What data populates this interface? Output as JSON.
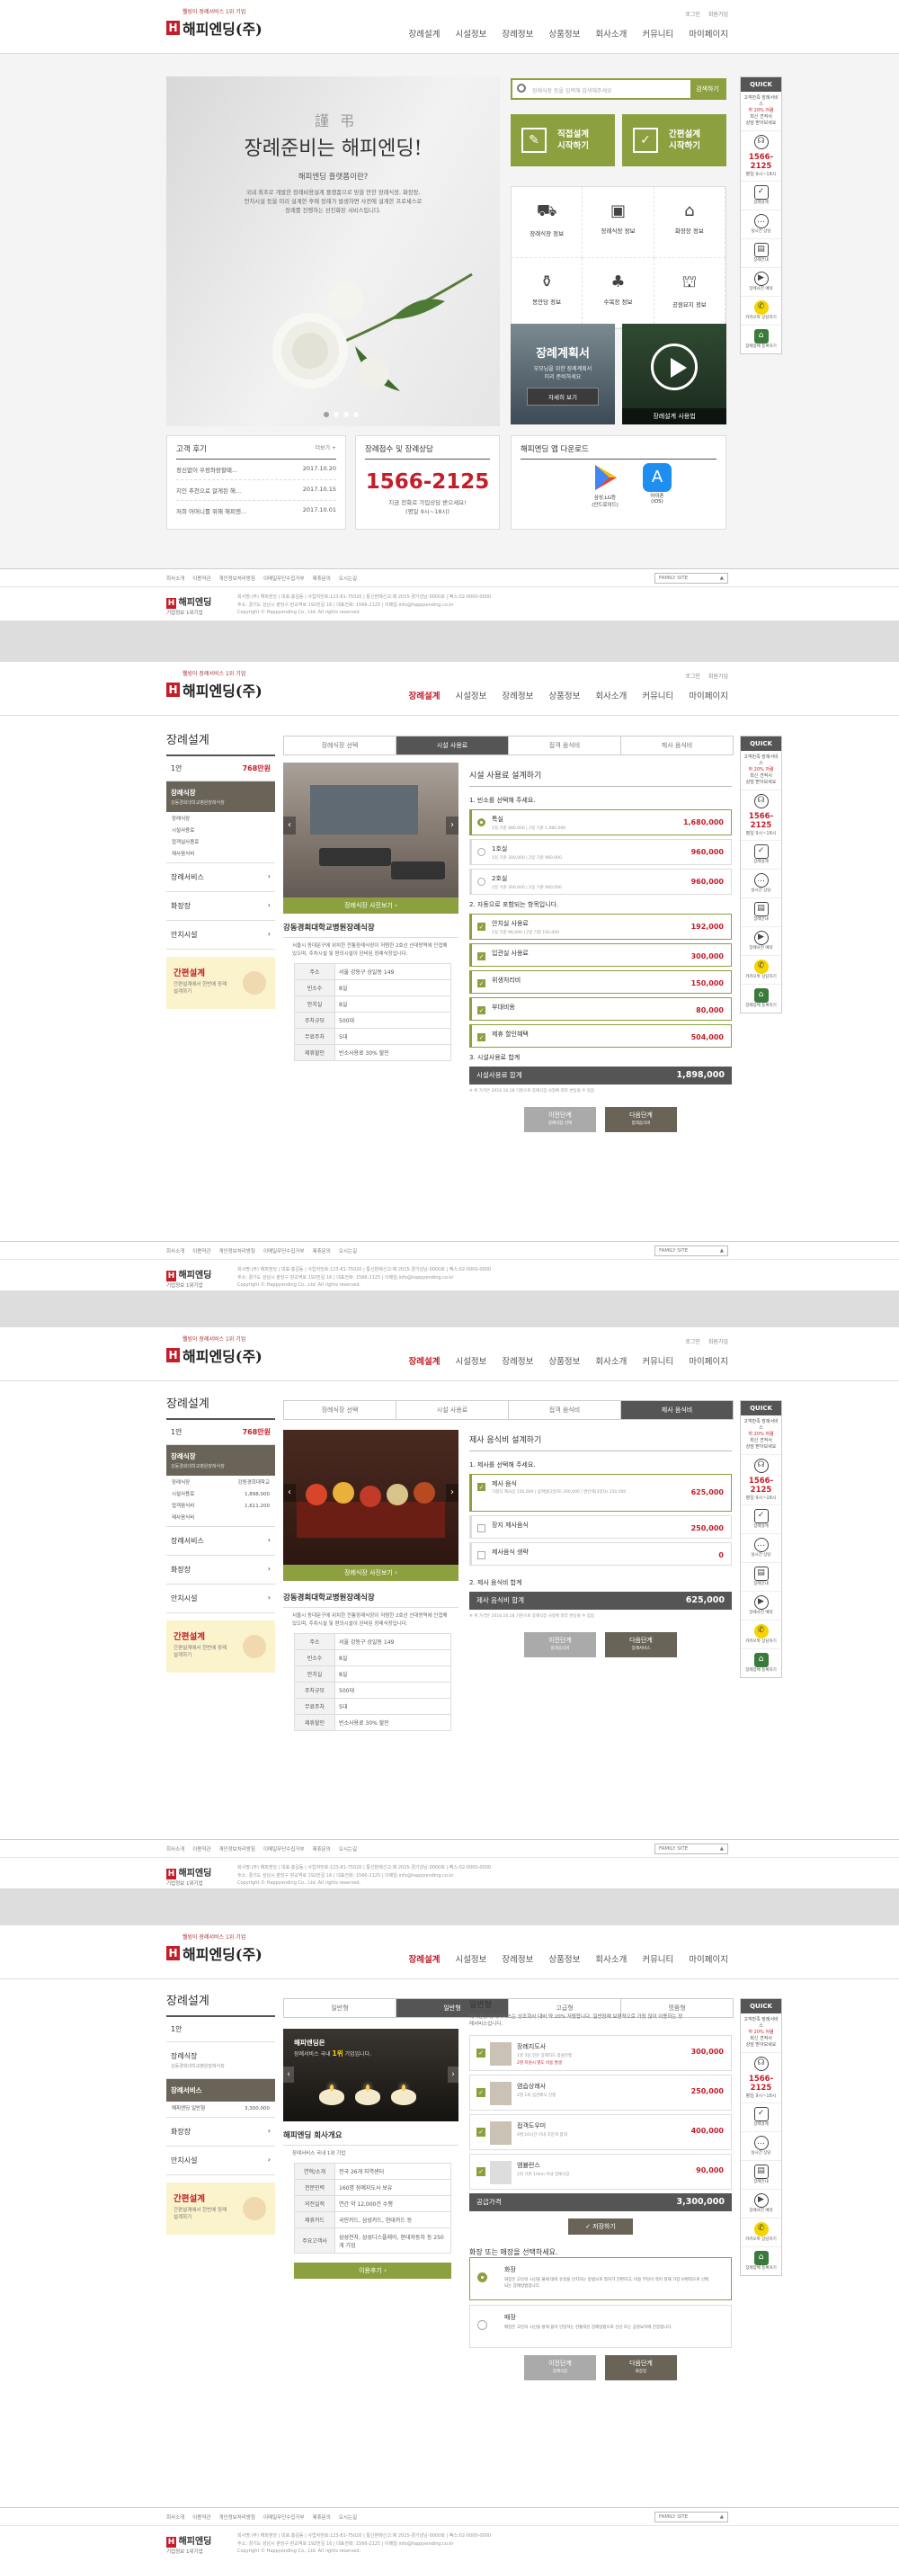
{
  "brand": {
    "tagline": "웰빙이 장례서비스 1위 기업",
    "name": "해피엔딩(주)",
    "ft_name": "해피엔딩",
    "ft_sub": "기업정보 1위기업"
  },
  "util": [
    "로그인",
    "회원가입"
  ],
  "gnb": [
    "장례설계",
    "시설정보",
    "장례정보",
    "상품정보",
    "회사소개",
    "커뮤니티",
    "마이페이지"
  ],
  "quick": {
    "title": "QUICK",
    "slogan1": "고객만족 장례서비스",
    "slogan2": "하 20% 저렴",
    "slogan3": "최신 견적서",
    "slogan4": "상담 받아보세요",
    "phone": "1566-2125",
    "hours": "평일 9시~18시",
    "items": [
      "장례설계",
      "실시간 상담",
      "장례안내",
      "장례사전 예약",
      "카카오톡 상담하기",
      "장례업체 등록하기"
    ]
  },
  "footer": {
    "links": [
      "회사소개",
      "이용약관",
      "개인정보처리방침",
      "이메일무단수집거부",
      "제휴문의",
      "오시는길"
    ],
    "family": "FAMILY SITE",
    "addr1": "회사명:(주) 해피엔딩 | 대표:홍길동 | 사업자번호:123-81-75020 | 통신판매신고:제 2015-경기성남-0000호 | 팩스:02-0000-0000",
    "addr2": "주소: 경기도 성남시 분당구 판교역로 192번길 16 | 대표전화: 1566-2125 | 이메일:info@happyending.co.kr",
    "copy": "Copyright © Happyending Co., Ltd. All rights reserved."
  },
  "home": {
    "hero": {
      "stamp": "謹弔",
      "title": "장례준비는 해피엔딩!",
      "subtitle": "해피엔딩 플랫폼이란?",
      "desc": "국내 최초로 개발한 장례비용설계 플랫폼으로 믿을 만한 장례식장, 화장장, 안치시설 등을 미리 설계한 후에 장례가 발생하면 사전에 설계한 프로세스로 장례를 진행하는 선진화된 서비스입니다."
    },
    "search": {
      "placeholder": "장례식장 등을 입력해 검색해주세요",
      "button": "검색하기"
    },
    "btn1": [
      "직접설계",
      "시작하기"
    ],
    "btn2": [
      "간편설계",
      "시작하기"
    ],
    "icons": [
      "장례식장 정보",
      "장례식장 정보",
      "화장장 정보",
      "봉안당 정보",
      "수목장 정보",
      "공원묘지 정보"
    ],
    "promo": {
      "t1": "장례계획서",
      "t2": "부모님을 위한 장례계획서",
      "t3": "미리 준비하세요",
      "btn": "자세히 보기"
    },
    "video": "장례설계 사용법",
    "review": {
      "title": "고객 후기",
      "more": "더보기 +",
      "items": [
        {
          "t": "정신없이 우왕좌왕할때...",
          "d": "2017.10.20"
        },
        {
          "t": "지인 추천으로 알게된 해...",
          "d": "2017.10.15"
        },
        {
          "t": "저희 어머니를 위해 해피엔...",
          "d": "2017.10.01"
        }
      ]
    },
    "call": {
      "title": "장례접수 및 장례상담",
      "phone": "1566-2125",
      "l1": "지금 전화로 가입상담 받으세요!",
      "l2": "(평일 9시~18시)"
    },
    "app": {
      "title": "해피엔딩 앱 다운로드",
      "a": "삼성,LG등",
      "a2": "(안드로이드)",
      "b": "아이폰",
      "b2": "(iOS)"
    }
  },
  "p2": {
    "menu": {
      "title": "장례설계",
      "day": "1안",
      "price": "768만원",
      "cat": "장례식장",
      "catsub": "강동경희대학교병원장례식장",
      "subs": [
        "장례식장",
        "강동경희대학교",
        "시설사용료",
        "접객실사용료",
        "제사음식비"
      ],
      "items": [
        "장례서비스",
        "화장장",
        "안치시설"
      ],
      "simple": "간편설계",
      "simple_d": "간편설계에서 한번에 장례 설계하기"
    },
    "steps": [
      "장례식장 선택",
      "시설 사용료",
      "접객 음식비",
      "제사 음식비"
    ],
    "photo": "장례식장 사진보기",
    "place": {
      "name": "강동경희대학교병원장례식장",
      "desc": "서울시 동대문구에 위치한 전통장례식장이 저렴한 2호선 신대방역에 인접해 있으며, 주차시설 및 편의시설이 완비된 장례식장입니다.",
      "rows": [
        [
          "주소",
          "서울 강동구 상일동 149"
        ],
        [
          "빈소수",
          "8실"
        ],
        [
          "안치실",
          "8실"
        ],
        [
          "주차규모",
          "500대"
        ],
        [
          "무료주차",
          "5대"
        ],
        [
          "제휴할인",
          "빈소사용료 30% 할인"
        ]
      ]
    },
    "h": "시설 사용료 설계하기",
    "q1": "1. 빈소를 선택해 주세요.",
    "rooms": [
      {
        "n": "특실",
        "s": "1일 기준 480,000 | 2일 기준 1,680,000",
        "p": "1,680,000"
      },
      {
        "n": "1호실",
        "s": "1일 기준 300,000 | 2일 기준 960,000",
        "p": "960,000"
      },
      {
        "n": "2호실",
        "s": "1일 기준 300,000 | 2일 기준 960,000",
        "p": "960,000"
      }
    ],
    "q2": "2. 자동으로 포함되는 항목입니다.",
    "auto": [
      {
        "n": "안치실 사용료",
        "s": "1일 기준 96,000 | 2일 기준 192,000",
        "p": "192,000"
      },
      {
        "n": "입관실 사용료",
        "s": "",
        "p": "300,000"
      },
      {
        "n": "위생처리비",
        "s": "",
        "p": "150,000"
      },
      {
        "n": "부대비용",
        "s": "",
        "p": "80,000"
      },
      {
        "n": "제휴 할인혜택",
        "s": "",
        "p": "504,000"
      }
    ],
    "q3": "3. 시설사용료 합계",
    "total_l": "시설사용료 합계",
    "total": "1,898,000",
    "note": "※ 위 가격은 2016.10.18 기준으로 장례식장 사정에 따라 변동될 수 있음",
    "prev": "이전단계",
    "prev_s": "장례식장 선택",
    "next": "다음단계",
    "next_s": "접객음식비"
  },
  "p3": {
    "steps": [
      "장례식장 선택",
      "시설 사용료",
      "접객 음식비",
      "제사 음식비"
    ],
    "subs": [
      [
        "장례식장",
        "강동경희대학교"
      ],
      [
        "시설사용료",
        "1,898,000"
      ],
      [
        "접객음식비",
        "1,611,200"
      ],
      [
        "제사음식비",
        ""
      ]
    ],
    "photo": "장례식장 사진보기",
    "h": "제사 음식비 설계하기",
    "q1": "1. 제사를 선택해 주세요.",
    "opts": [
      {
        "n": "제사 음식",
        "s": "가정식 제사상 150,000 | 상여밥(2일차) 200,000 | 발인제(3일차) 150,000",
        "p": "625,000"
      },
      {
        "n": "장지 제사음식",
        "s": "",
        "p": "250,000"
      },
      {
        "n": "제사음식 생략",
        "s": "",
        "p": "0"
      }
    ],
    "q2": "2. 제사 음식비 합계",
    "total_l": "제사 음식비 합계",
    "total": "625,000",
    "prev_s": "접객음식비",
    "next_s": "장례서비스"
  },
  "p4": {
    "subs": [
      [
        "장례식장",
        "강동경희대학교병원장례식장"
      ]
    ],
    "cat2": "장례서비스",
    "cat2sub": "해피엔딩 일반형",
    "cat2p": "3,300,000",
    "steps": [
      "일반형",
      "일반형",
      "고급형",
      "명품형"
    ],
    "banner": {
      "t1": "해피엔딩은",
      "t2": "장례서비스 국내",
      "t3": "1위",
      "t4": "기업입니다."
    },
    "co": {
      "name": "해피엔딩 회사개요",
      "desc": "장례서비스 국내 1위 기업",
      "rows": [
        [
          "연혁/소개",
          "전국 26개 지역센터"
        ],
        [
          "전문인력",
          "160명 장례지도사 보유"
        ],
        [
          "의전실적",
          "연간 약 12,000건 수행"
        ],
        [
          "제휴카드",
          "국민카드, 삼성카드, 현대카드 등"
        ],
        [
          "주요고객사",
          "삼성전자, 삼성디스플레이, 현대자동차 등 250개 기업"
        ]
      ],
      "btn": "이용후기"
    },
    "h": "일반형",
    "intro": "해피엔딩 장례서비스는 상조회사 대비 약 20% 저렴합니다. 일반장례 보편적으로 가장 많이 이용하는 장례서비스입니다.",
    "svcs": [
      {
        "n": "장례지도사",
        "s": "1명 3일 전문 장례지도 총괄진행",
        "e": "2명 지원시 별도 비용 발생",
        "p": "300,000"
      },
      {
        "n": "염습상례사",
        "s": "2명 1회 입관예식 진행",
        "e": "",
        "p": "250,000"
      },
      {
        "n": "접객도우미",
        "s": "4명 10시간 이내 조문객 접대",
        "e": "",
        "p": "400,000"
      },
      {
        "n": "앰뷸런스",
        "s": "1회 기본 10km 이내 장례식장",
        "e": "",
        "p": "90,000"
      }
    ],
    "total_l": "공급가격",
    "total": "3,300,000",
    "save": "저장하기",
    "q": "화장 또는 매장을 선택하세요.",
    "burial": [
      {
        "n": "화장",
        "s": "화장은 고인의 시신을 불에 태워 유골을 안치하는 방법으로 절차가 간편하고, 비용 부담이 적어 현재 가장 보편적으로 선택되는 장례방법입니다."
      },
      {
        "n": "매장",
        "s": "매장은 고인의 시신을 땅에 묻어 안장하는 전통적인 장례방법으로 선산 또는 공원묘지에 안장합니다."
      }
    ],
    "prev_s": "장례식장",
    "next_s": "화장장"
  }
}
